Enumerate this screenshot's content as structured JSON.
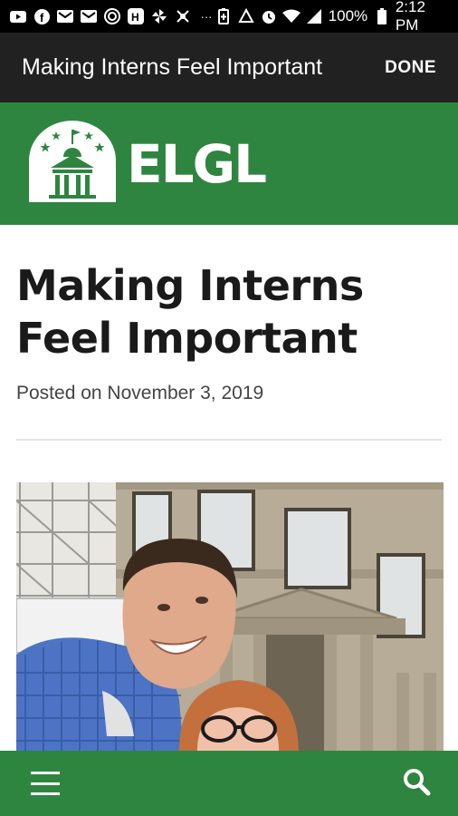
{
  "status_bar": {
    "left_icons": [
      "youtube-icon",
      "facebook-icon",
      "gmail-icon",
      "gmail-icon",
      "target-icon",
      "hbo-icon",
      "pinwheel-icon",
      "transform-icon"
    ],
    "more": "···",
    "right_icons": [
      "battery-saver-icon",
      "recycle-icon",
      "alarm-icon",
      "wifi-icon",
      "signal-icon"
    ],
    "battery": "100%",
    "time": "2:12 PM"
  },
  "app_bar": {
    "title": "Making Interns Feel Important",
    "done_label": "DONE"
  },
  "site": {
    "logo_text": "ELGL",
    "brand_color": "#2e8540"
  },
  "post": {
    "title": "Making Interns Feel Important",
    "meta_prefix": "Posted on",
    "date": "November 3, 2019"
  },
  "bottom_bar": {
    "menu_icon": "menu-icon",
    "search_icon": "search-icon"
  }
}
